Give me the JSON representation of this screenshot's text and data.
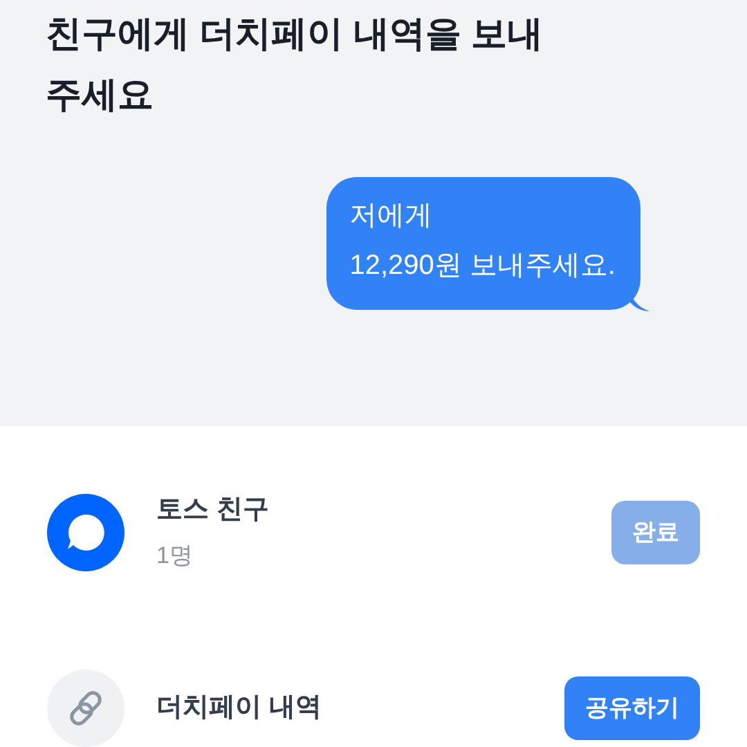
{
  "title": "친구에게 더치페이 내역을 보내주세요",
  "message": {
    "lines": [
      "저에게",
      "12,290원 보내주세요."
    ]
  },
  "items": [
    {
      "kind": "friend",
      "name": "토스 친구",
      "subtitle": "1명",
      "button": {
        "label": "완료",
        "disabled": true
      }
    },
    {
      "kind": "link",
      "name": "더치페이 내역",
      "button": {
        "label": "공유하기",
        "disabled": false
      }
    }
  ]
}
